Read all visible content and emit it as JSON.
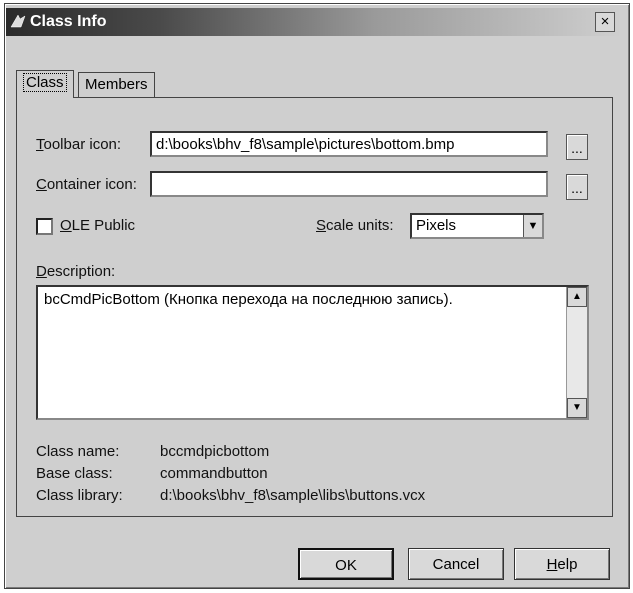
{
  "window": {
    "title": "Class Info",
    "close_glyph": "×"
  },
  "tabs": [
    {
      "label": "Class",
      "active": true
    },
    {
      "label": "Members",
      "active": false
    }
  ],
  "class_tab": {
    "toolbar_icon": {
      "label_prefix": "",
      "label_underlined": "T",
      "label_rest": "oolbar icon:",
      "value": "d:\\books\\bhv_f8\\sample\\pictures\\bottom.bmp",
      "browse_label": "..."
    },
    "container_icon": {
      "label_underlined": "C",
      "label_rest": "ontainer icon:",
      "value": "",
      "browse_label": "..."
    },
    "ole_public": {
      "label_underlined": "O",
      "label_rest": "LE Public",
      "checked": false
    },
    "scale_units": {
      "label_underlined": "S",
      "label_rest": "cale units:",
      "value": "Pixels"
    },
    "description": {
      "label_underlined": "D",
      "label_rest": "escription:",
      "value": "bcCmdPicBottom (Кнопка перехода на последнюю запись)."
    },
    "info": [
      {
        "label": "Class name:",
        "value": "bccmdpicbottom"
      },
      {
        "label": "Base class:",
        "value": "commandbutton"
      },
      {
        "label": "Class library:",
        "value": "d:\\books\\bhv_f8\\sample\\libs\\buttons.vcx"
      }
    ]
  },
  "buttons": {
    "ok": "OK",
    "cancel": "Cancel",
    "help_underlined": "H",
    "help_rest": "elp"
  },
  "icons": {
    "title": "app-icon",
    "close": "close-icon",
    "scroll_up": "scroll-up-arrow-icon",
    "scroll_down": "scroll-down-arrow-icon",
    "dropdown": "chevron-down-icon"
  }
}
